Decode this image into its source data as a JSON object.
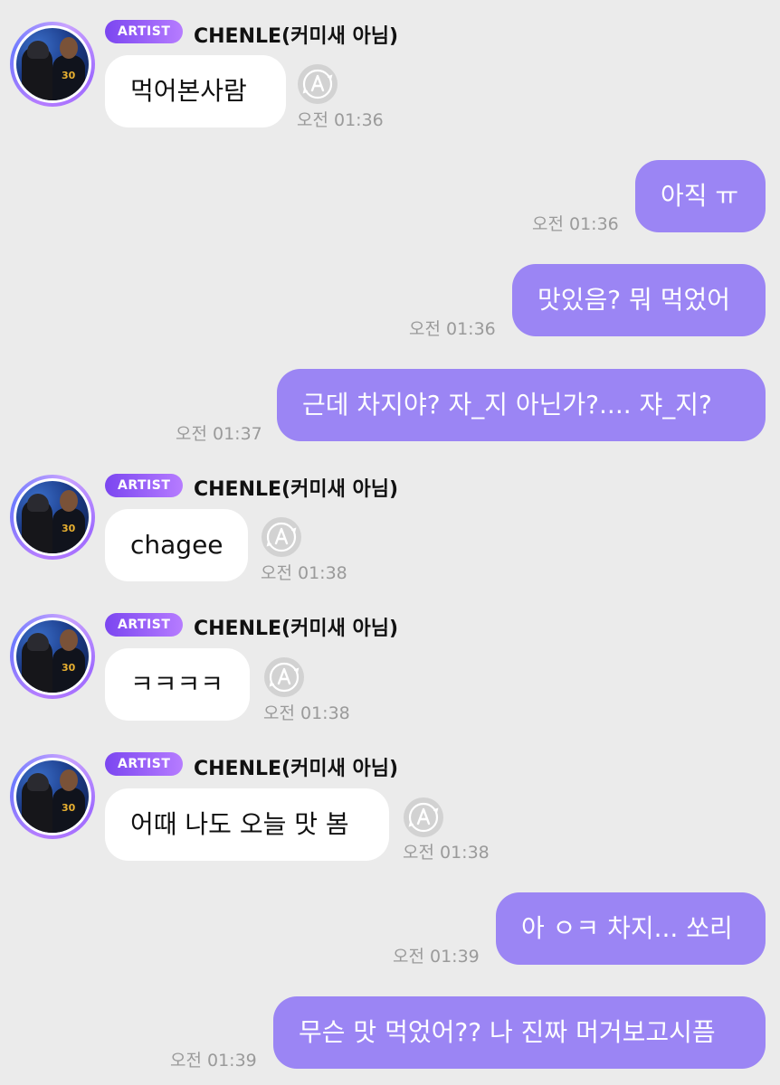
{
  "chat": {
    "artist_badge": "ARTIST",
    "sender_name": "CHENLE(커미새 아님)",
    "avatar_jersey": "30",
    "messages": [
      {
        "dir": "in",
        "text": "먹어본사람",
        "time": "오전 01:36"
      },
      {
        "dir": "out",
        "text": "아직 ㅠ",
        "time": "오전 01:36"
      },
      {
        "dir": "out",
        "text": "맛있음? 뭐 먹었어",
        "time": "오전 01:36"
      },
      {
        "dir": "out",
        "text": "근데 차지야? 자_지 아닌가?.... 쟈_지?",
        "time": "오전 01:37"
      },
      {
        "dir": "in",
        "text": "chagee",
        "time": "오전 01:38"
      },
      {
        "dir": "in",
        "text": "ㅋㅋㅋㅋ",
        "time": "오전 01:38"
      },
      {
        "dir": "in",
        "text": "어때 나도 오늘 맛 봄",
        "time": "오전 01:38"
      },
      {
        "dir": "out",
        "text": "아 ㅇㅋ 차지... 쏘리",
        "time": "오전 01:39"
      },
      {
        "dir": "out",
        "text": "무슨 맛 먹었어?? 나 진짜 머거보고시픔",
        "time": "오전 01:39"
      }
    ]
  },
  "icons": {
    "translate": "translate-icon"
  },
  "colors": {
    "outgoing_bubble": "#9b85f4",
    "badge_start": "#7b46f0",
    "badge_end": "#b67cff",
    "background": "#ebebeb"
  }
}
